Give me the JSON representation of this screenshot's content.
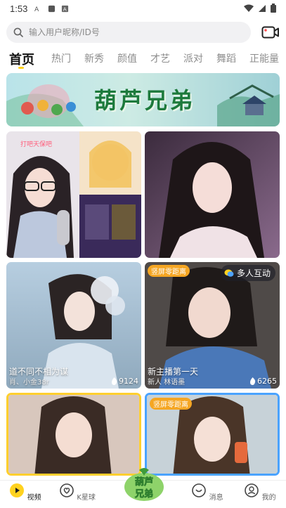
{
  "status_bar": {
    "time": "1:53"
  },
  "search": {
    "placeholder": "输入用户昵称/ID号"
  },
  "tabs": [
    {
      "label": "首页",
      "active": true
    },
    {
      "label": "热门"
    },
    {
      "label": "新秀"
    },
    {
      "label": "颜值"
    },
    {
      "label": "才艺"
    },
    {
      "label": "派对"
    },
    {
      "label": "舞蹈"
    },
    {
      "label": "正能量"
    }
  ],
  "banner": {
    "title": "葫芦兄弟"
  },
  "cards": [
    {
      "overlay_text": "打吧天保吧"
    },
    {},
    {
      "caption": "道不同不相为谋",
      "sub": "肖、小金38r",
      "views": "9124"
    },
    {
      "tag": "竖屏零距离",
      "interact": "多人互动",
      "caption": "新主播第一天",
      "sub": "新人 林语墨",
      "views": "6265"
    },
    {},
    {
      "tag": "竖屏零距离"
    }
  ],
  "center_logo": {
    "text_top": "葫芦",
    "text_bottom": "兄弟"
  },
  "bottom_nav": [
    {
      "label": "视频",
      "icon": "video-icon",
      "active": true
    },
    {
      "label": "K星球",
      "icon": "heart-planet-icon"
    },
    {
      "label": "消息",
      "icon": "message-icon"
    },
    {
      "label": "我的",
      "icon": "profile-icon"
    }
  ],
  "colors": {
    "accent": "#ffd21f",
    "tag": "#f5a623",
    "banner_green": "#1d7a3c"
  }
}
